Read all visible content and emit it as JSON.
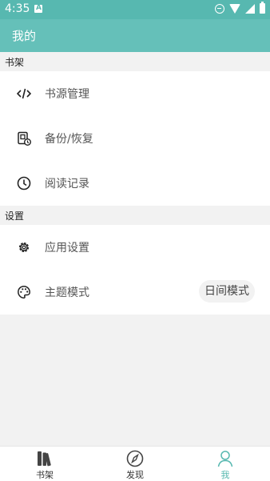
{
  "status_bar": {
    "time": "4:35",
    "icons": [
      "a-notification-icon",
      "do-not-disturb-icon",
      "wifi-icon",
      "signal-icon",
      "battery-icon"
    ]
  },
  "app_bar": {
    "title": "我的"
  },
  "sections": {
    "bookshelf": {
      "header": "书架",
      "items": [
        {
          "label": "书源管理",
          "icon": "code-icon"
        },
        {
          "label": "备份/恢复",
          "icon": "backup-restore-icon"
        },
        {
          "label": "阅读记录",
          "icon": "clock-icon"
        }
      ]
    },
    "settings": {
      "header": "设置",
      "items": [
        {
          "label": "应用设置",
          "icon": "gear-icon"
        },
        {
          "label": "主题模式",
          "icon": "palette-icon",
          "value": "日间模式"
        }
      ]
    }
  },
  "bottom_nav": {
    "tabs": [
      {
        "label": "书架",
        "icon": "bookshelf-icon",
        "active": false
      },
      {
        "label": "发现",
        "icon": "compass-icon",
        "active": false
      },
      {
        "label": "我",
        "icon": "person-icon",
        "active": true
      }
    ]
  },
  "colors": {
    "status_bar": "#57b8b0",
    "app_bar": "#65c0b9",
    "accent": "#57b8b0",
    "background": "#f2f2f2"
  }
}
